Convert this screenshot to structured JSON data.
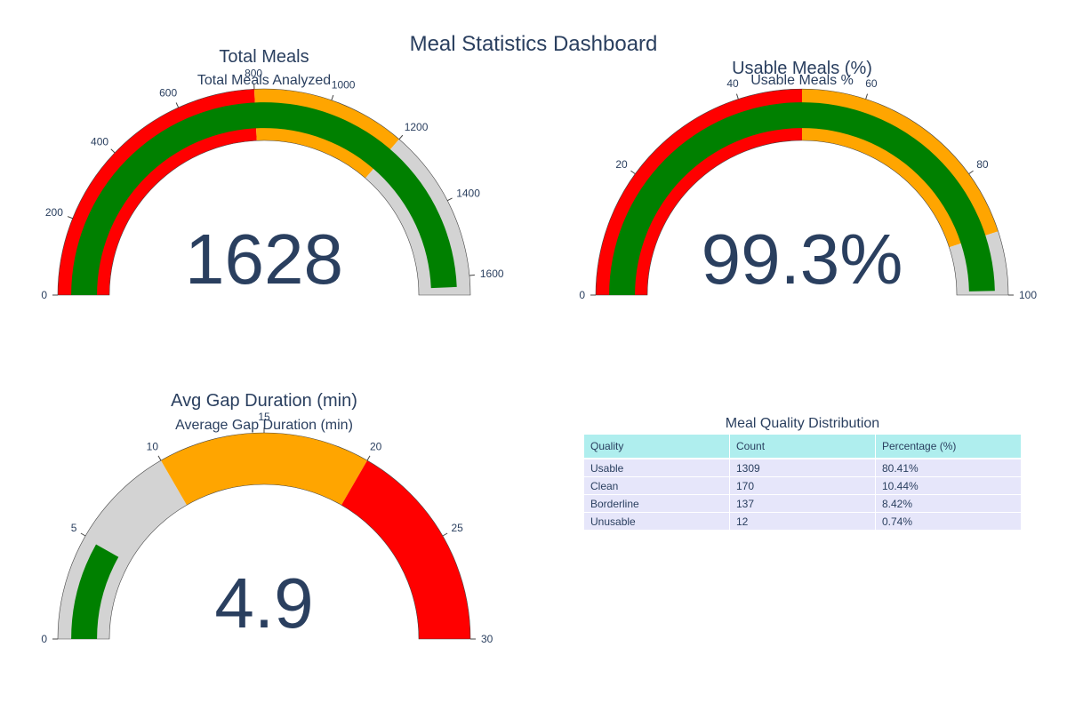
{
  "dashboard_title": "Meal Statistics Dashboard",
  "colors": {
    "text": "#2a3f5f",
    "green": "#008000",
    "red": "#ff0000",
    "orange": "#ffa500",
    "gray": "#d3d3d3",
    "table_header": "#afeeee",
    "table_cells": "#e6e6fa"
  },
  "chart_data": [
    {
      "type": "gauge",
      "title": "Total Meals",
      "subtitle": "Total Meals Analyzed",
      "value": 1628,
      "value_text": "1628",
      "range": [
        0,
        1650
      ],
      "ticks": [
        0,
        200,
        400,
        600,
        800,
        1000,
        1200,
        1400,
        1600
      ],
      "bar_color": "green",
      "steps": [
        {
          "range": [
            0,
            800
          ],
          "color": "red"
        },
        {
          "range": [
            800,
            1200
          ],
          "color": "orange"
        },
        {
          "range": [
            1200,
            1650
          ],
          "color": "gray"
        }
      ]
    },
    {
      "type": "gauge",
      "title": "Usable Meals (%)",
      "subtitle": "Usable Meals %",
      "value": 99.3,
      "value_text": "99.3%",
      "range": [
        0,
        100
      ],
      "ticks": [
        0,
        20,
        40,
        60,
        80,
        100
      ],
      "bar_color": "green",
      "steps": [
        {
          "range": [
            0,
            50
          ],
          "color": "red"
        },
        {
          "range": [
            50,
            90
          ],
          "color": "orange"
        },
        {
          "range": [
            90,
            100
          ],
          "color": "gray"
        }
      ]
    },
    {
      "type": "gauge",
      "title": "Avg Gap Duration (min)",
      "subtitle": "Average Gap Duration (min)",
      "value": 4.9,
      "value_text": "4.9",
      "range": [
        0,
        30
      ],
      "ticks": [
        0,
        5,
        10,
        15,
        20,
        25,
        30
      ],
      "bar_color": "green",
      "steps": [
        {
          "range": [
            0,
            10
          ],
          "color": "gray"
        },
        {
          "range": [
            10,
            20
          ],
          "color": "orange"
        },
        {
          "range": [
            20,
            30
          ],
          "color": "red"
        }
      ]
    },
    {
      "type": "table",
      "title": "Meal Quality Distribution",
      "columns": [
        "Quality",
        "Count",
        "Percentage (%)"
      ],
      "rows": [
        [
          "Usable",
          "1309",
          "80.41%"
        ],
        [
          "Clean",
          "170",
          "10.44%"
        ],
        [
          "Borderline",
          "137",
          "8.42%"
        ],
        [
          "Unusable",
          "12",
          "0.74%"
        ]
      ]
    }
  ]
}
